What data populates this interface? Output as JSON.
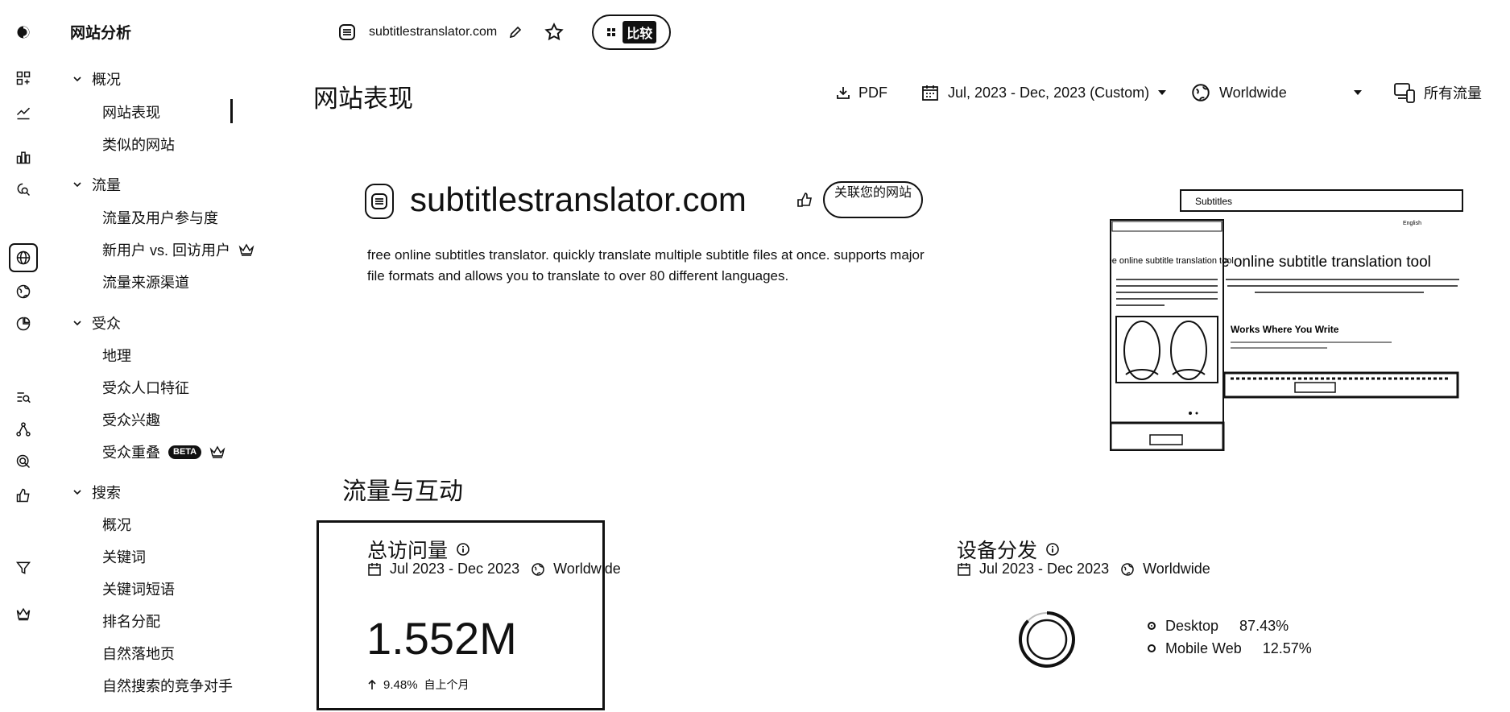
{
  "rail": {
    "icons": [
      "logo-icon",
      "dashboard-icon",
      "trend-icon",
      "bar-chart-icon",
      "search-site-icon",
      "globe-icon",
      "world-icon",
      "pie-icon",
      "keyword-search-icon",
      "network-icon",
      "target-icon",
      "thumbs-up-icon",
      "filter-icon",
      "crown-icon"
    ]
  },
  "sidebar": {
    "title": "网站分析",
    "sections": [
      {
        "label": "概况",
        "items": [
          {
            "label": "网站表现"
          },
          {
            "label": "类似的网站"
          }
        ]
      },
      {
        "label": "流量",
        "items": [
          {
            "label": "流量及用户参与度"
          },
          {
            "label": "新用户 vs. 回访用户"
          },
          {
            "label": "流量来源渠道"
          }
        ]
      },
      {
        "label": "受众",
        "items": [
          {
            "label": "地理"
          },
          {
            "label": "受众人口特征"
          },
          {
            "label": "受众兴趣"
          },
          {
            "label": "受众重叠",
            "badge": "BETA"
          }
        ]
      },
      {
        "label": "搜索",
        "items": [
          {
            "label": "概况"
          },
          {
            "label": "关键词"
          },
          {
            "label": "关键词短语"
          },
          {
            "label": "排名分配"
          },
          {
            "label": "自然落地页"
          },
          {
            "label": "自然搜索的竞争对手"
          }
        ]
      }
    ]
  },
  "header": {
    "domain": "subtitlestranslator.com",
    "compare_label": "比较"
  },
  "page": {
    "title": "网站表现",
    "pdf_label": "PDF",
    "date_range": "Jul, 2023 - Dec, 2023 (Custom)",
    "region": "Worldwide",
    "traffic_filter": "所有流量"
  },
  "site": {
    "name": "subtitlestranslator.com",
    "connect_label": "关联您的网站",
    "description": "free online subtitles translator. quickly translate multiple subtitle files at once. supports major file formats and allows you to translate to over 80 different languages."
  },
  "thumbnail": {
    "header": "Subtitles",
    "lang": "English",
    "headline": "e online subtitle translation tool",
    "mobile_headline": "Free online subtitle translation tool",
    "works": "Works Where You Write"
  },
  "section": {
    "title": "流量与互动"
  },
  "visits": {
    "title": "总访问量",
    "date": "Jul 2023 - Dec 2023",
    "region": "Worldwide",
    "value": "1.552M",
    "growth": "9.48%",
    "growth_label": "自上个月"
  },
  "devices": {
    "title": "设备分发",
    "date": "Jul 2023 - Dec 2023",
    "region": "Worldwide",
    "items": [
      {
        "label": "Desktop",
        "pct": "87.43%",
        "value": 87.43
      },
      {
        "label": "Mobile Web",
        "pct": "12.57%",
        "value": 12.57
      }
    ]
  }
}
